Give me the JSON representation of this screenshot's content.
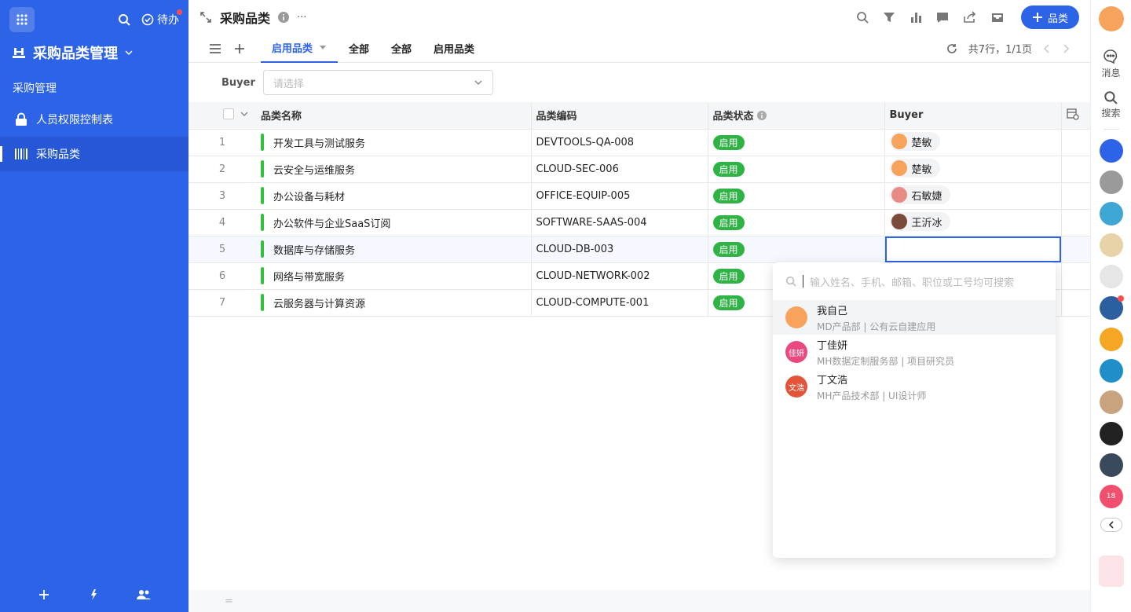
{
  "sidebar": {
    "todo_label": "待办",
    "app_title": "采购品类管理",
    "section": "采购管理",
    "items": [
      {
        "label": "人员权限控制表"
      },
      {
        "label": "采购品类"
      }
    ]
  },
  "topbar": {
    "title": "采购品类",
    "add_label": "品类"
  },
  "tabs": [
    {
      "label": "启用品类"
    },
    {
      "label": "全部"
    },
    {
      "label": "全部"
    },
    {
      "label": "启用品类"
    }
  ],
  "pager": {
    "text": "共7行，1/1页"
  },
  "filter": {
    "label": "Buyer",
    "placeholder": "请选择"
  },
  "table": {
    "headers": [
      "品类名称",
      "品类编码",
      "品类状态",
      "Buyer"
    ],
    "rows": [
      {
        "n": "1",
        "name": "开发工具与测试服务",
        "code": "DEVTOOLS-QA-008",
        "status": "启用",
        "buyer": "楚敏"
      },
      {
        "n": "2",
        "name": "云安全与运维服务",
        "code": "CLOUD-SEC-006",
        "status": "启用",
        "buyer": "楚敏"
      },
      {
        "n": "3",
        "name": "办公设备与耗材",
        "code": "OFFICE-EQUIP-005",
        "status": "启用",
        "buyer": "石敏婕"
      },
      {
        "n": "4",
        "name": "办公软件与企业SaaS订阅",
        "code": "SOFTWARE-SAAS-004",
        "status": "启用",
        "buyer": "王沂冰"
      },
      {
        "n": "5",
        "name": "数据库与存储服务",
        "code": "CLOUD-DB-003",
        "status": "启用",
        "buyer": ""
      },
      {
        "n": "6",
        "name": "网络与带宽服务",
        "code": "CLOUD-NETWORK-002",
        "status": "启用",
        "buyer": ""
      },
      {
        "n": "7",
        "name": "云服务器与计算资源",
        "code": "CLOUD-COMPUTE-001",
        "status": "启用",
        "buyer": ""
      }
    ]
  },
  "statusbar": {
    "symbol": "="
  },
  "dropdown": {
    "placeholder": "输入姓名、手机、邮箱、职位或工号均可搜索",
    "options": [
      {
        "name": "我自己",
        "sub": "MD产品部 | 公有云自建应用",
        "avatar_text": "",
        "color": "#f7a35c"
      },
      {
        "name": "丁佳妍",
        "sub": "MH数据定制服务部 | 项目研究员",
        "avatar_text": "佳妍",
        "color": "#e84a7f"
      },
      {
        "name": "丁文浩",
        "sub": "MH产品技术部 | UI设计师",
        "avatar_text": "文浩",
        "color": "#e2553a"
      }
    ]
  },
  "rail": {
    "messages_label": "消息",
    "search_label": "搜索",
    "calendar_day": "18"
  },
  "colors": {
    "primary": "#2d63e6",
    "status_green": "#2fb344"
  }
}
